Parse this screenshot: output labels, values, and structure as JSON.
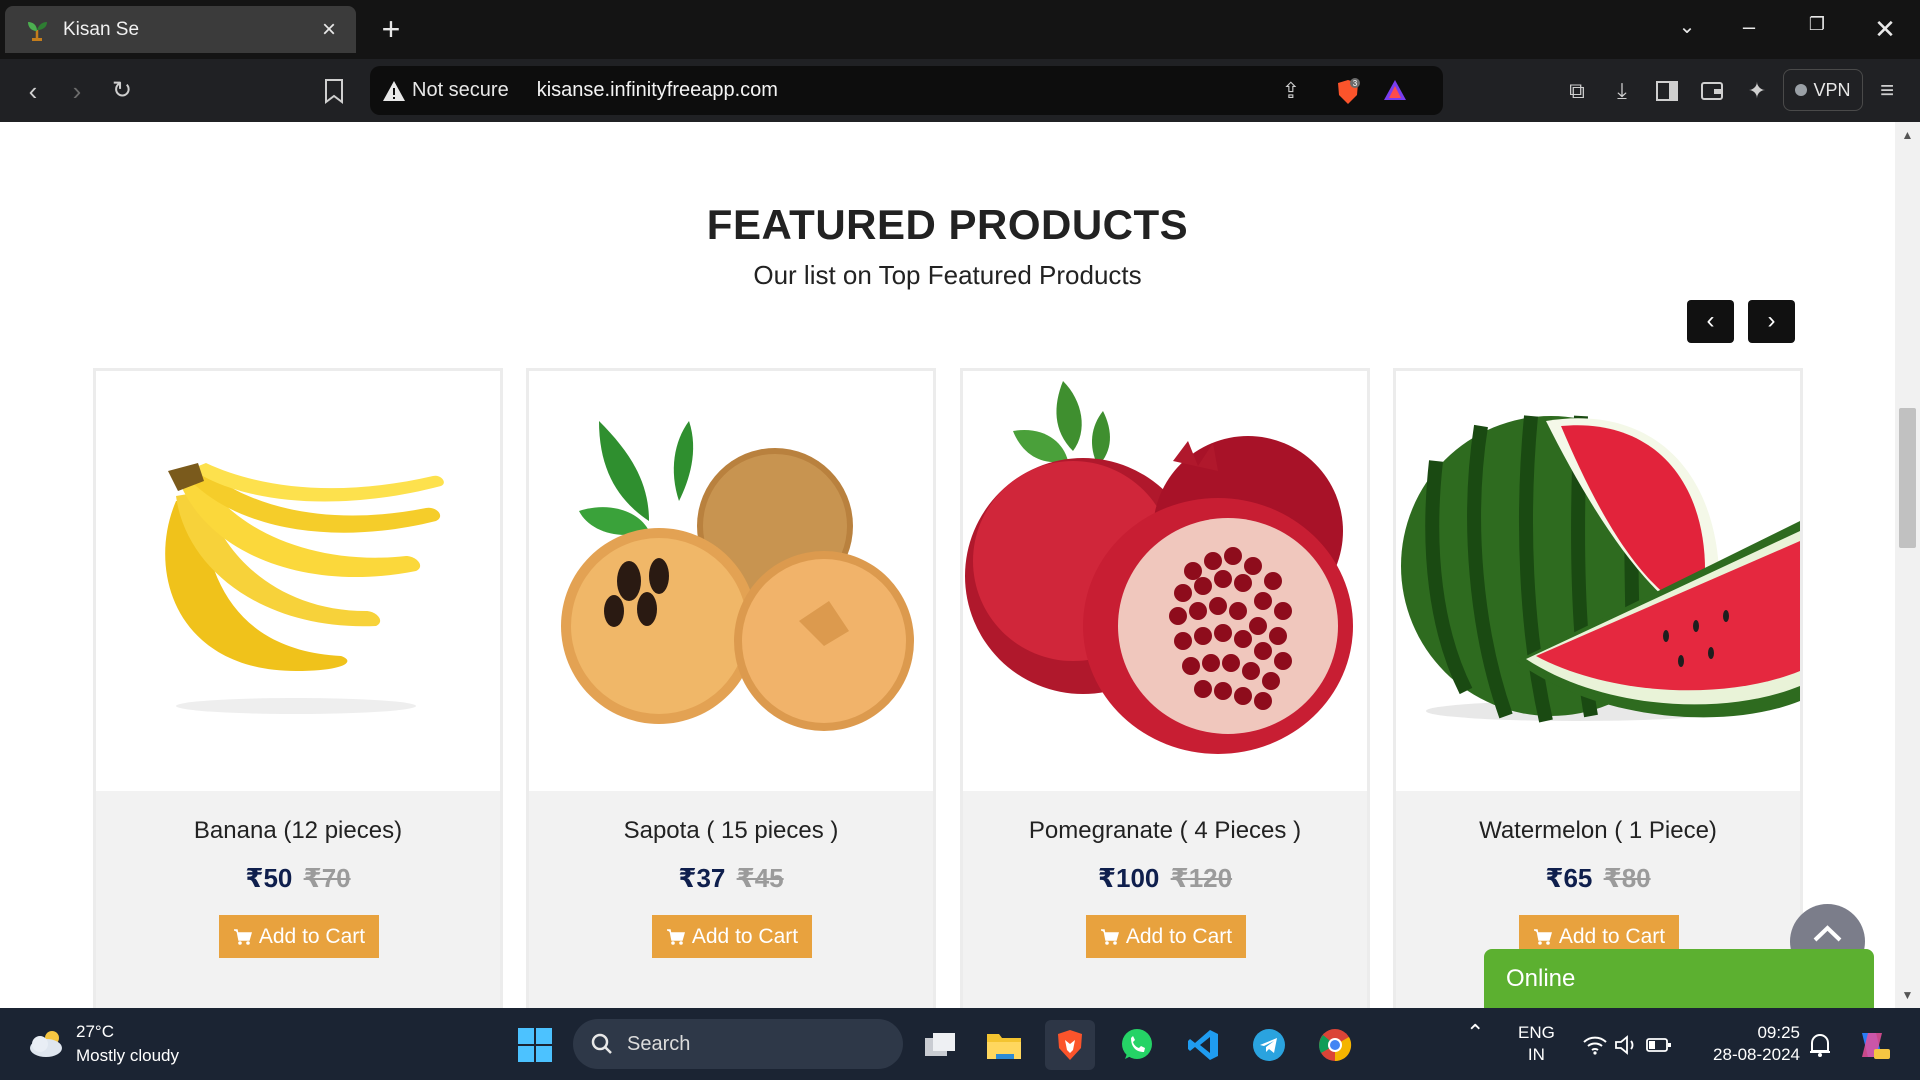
{
  "browser": {
    "tab_title": "Kisan Se",
    "security_label": "Not secure",
    "url": "kisanse.infinityfreeapp.com",
    "shield_badge": "3",
    "vpn_label": "VPN"
  },
  "page": {
    "section_title": "FEATURED PRODUCTS",
    "section_subtitle": "Our list on Top Featured Products",
    "prev_label": "‹",
    "next_label": "›",
    "products": [
      {
        "name": "Banana (12 pieces)",
        "price": "₹50",
        "old_price": "₹70",
        "button": "Add to Cart",
        "image": "banana"
      },
      {
        "name": "Sapota ( 15 pieces )",
        "price": "₹37",
        "old_price": "₹45",
        "button": "Add to Cart",
        "image": "sapota"
      },
      {
        "name": "Pomegranate ( 4 Pieces )",
        "price": "₹100",
        "old_price": "₹120",
        "button": "Add to Cart",
        "image": "pomegranate"
      },
      {
        "name": "Watermelon ( 1 Piece)",
        "price": "₹65",
        "old_price": "₹80",
        "button": "Add to Cart",
        "image": "watermelon"
      }
    ],
    "chat_label": "Online"
  },
  "taskbar": {
    "temperature": "27°C",
    "weather": "Mostly cloudy",
    "search_placeholder": "Search",
    "lang_top": "ENG",
    "lang_bottom": "IN",
    "time": "09:25",
    "date": "28-08-2024"
  },
  "colors": {
    "accent_button": "#e8a23e",
    "price_color": "#0f1f4d",
    "chat_green": "#5cb030"
  }
}
